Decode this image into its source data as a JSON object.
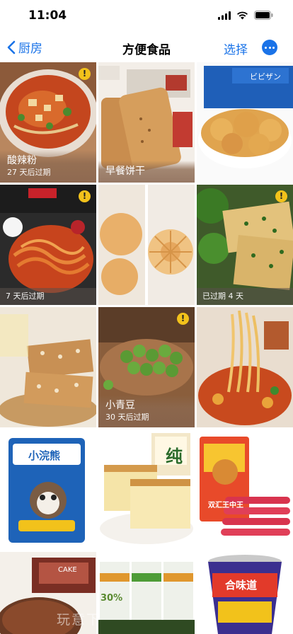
{
  "status": {
    "time": "11:04"
  },
  "nav": {
    "back_label": "厨房",
    "title": "方便食品",
    "select_label": "选择"
  },
  "colors": {
    "accent": "#1a73e8",
    "warning": "#f2c21b"
  },
  "items": [
    {
      "name": "酸辣粉",
      "expiry": "27 天后过期",
      "warning": true
    },
    {
      "name": "早餐饼干",
      "expiry": "",
      "warning": false
    },
    {
      "name": "",
      "expiry": "",
      "warning": false,
      "pack_text": "ビビザン"
    },
    {
      "name": "",
      "expiry": "7 天后过期",
      "warning": true
    },
    {
      "name": "",
      "expiry": "",
      "warning": false
    },
    {
      "name": "",
      "expiry": "已过期 4 天",
      "warning": true
    },
    {
      "name": "",
      "expiry": "",
      "warning": false
    },
    {
      "name": "小青豆",
      "expiry": "30 天后过期",
      "warning": true
    },
    {
      "name": "",
      "expiry": "",
      "warning": false
    },
    {
      "name": "",
      "expiry": "",
      "warning": false,
      "pack_text": "小浣熊"
    },
    {
      "name": "",
      "expiry": "",
      "warning": false,
      "pack_text": "纯"
    },
    {
      "name": "",
      "expiry": "",
      "warning": false,
      "pack_text": "双汇王中王"
    },
    {
      "name": "",
      "expiry": "",
      "warning": false,
      "pack_text": "CAKE"
    },
    {
      "name": "",
      "expiry": "",
      "warning": false,
      "pack_text": "30%"
    },
    {
      "name": "",
      "expiry": "",
      "warning": false,
      "pack_text": "合味道"
    }
  ],
  "watermark": "玩意下"
}
